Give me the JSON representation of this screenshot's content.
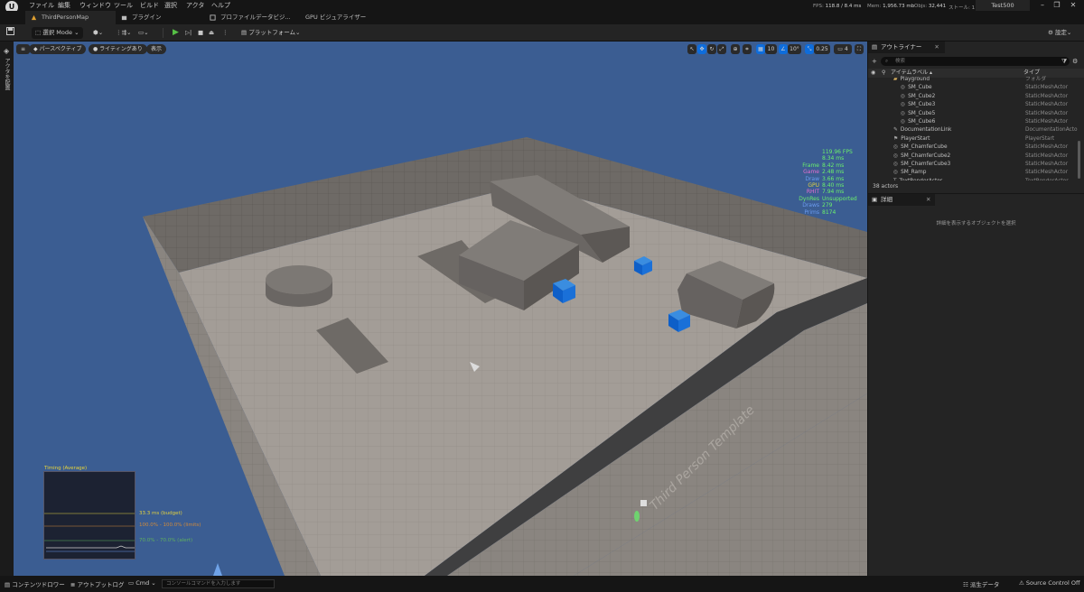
{
  "menubar": {
    "items": [
      "ファイル",
      "編集",
      "ウィンドウ",
      "ツール",
      "ビルド",
      "選択",
      "アクタ",
      "ヘルプ"
    ],
    "stats": {
      "fps_label": "FPS:",
      "fps_value": "118.8 / 8.4 ms",
      "mem_label": "Mem:",
      "mem_value": "1,956.73 mb",
      "objs_label": "Objs:",
      "objs_value": "32,441",
      "extra": "ストール: 1"
    },
    "project": "Test500"
  },
  "tabs": {
    "map": "ThirdPersonMap",
    "plugin": "プラグイン",
    "profile": "プロファイルデータビジ...",
    "gpu": "GPU ビジュアライザー"
  },
  "toolbar": {
    "mode": "選択 Mode",
    "platform": "プラットフォーム",
    "settings": "設定"
  },
  "leftstrip": {
    "label": "アクタを配置"
  },
  "viewport": {
    "perspective": "パースペクティブ",
    "lighting": "ライティングあり",
    "show": "表示",
    "grid_snap": "10",
    "rot_snap": "10°",
    "scale_snap": "0.25",
    "camera_speed": "4",
    "perf": [
      {
        "label": "",
        "value": "119.96 FPS",
        "color": "#6cf06c"
      },
      {
        "label": "",
        "value": "8.34 ms",
        "color": "#6cf06c"
      },
      {
        "label": "Frame",
        "value": "8.42 ms",
        "color": "#6cf06c"
      },
      {
        "label": "Game",
        "value": "2.48 ms",
        "color": "#e56fd0"
      },
      {
        "label": "Draw",
        "value": "3.66 ms",
        "color": "#6c9cf0"
      },
      {
        "label": "GPU",
        "value": "8.40 ms",
        "color": "#e0d040"
      },
      {
        "label": "RHIT",
        "value": "7.94 ms",
        "color": "#e56fd0"
      },
      {
        "label": "DynRes",
        "value": "Unsupported",
        "color": "#6cf06c"
      },
      {
        "label": "Draws",
        "value": "279",
        "color": "#6c9cf0"
      },
      {
        "label": "Prims",
        "value": "8174",
        "color": "#6c9cf0"
      }
    ],
    "graph": {
      "title": "Timing (Average)",
      "budget": "33.3 ms (budget)",
      "range1": "100.0% - 100.0% (limits)",
      "range2": "70.0% - 70.0% (alert)"
    }
  },
  "outliner": {
    "tab": "アウトライナー",
    "search_placeholder": "検索",
    "col_label": "アイテムラベル",
    "col_type": "タイプ",
    "rows": [
      {
        "label": "Playground",
        "type": "フォルダ",
        "indent": 1,
        "icon": "folder"
      },
      {
        "label": "SM_Cube",
        "type": "StaticMeshActor",
        "indent": 2,
        "icon": "mesh"
      },
      {
        "label": "SM_Cube2",
        "type": "StaticMeshActor",
        "indent": 2,
        "icon": "mesh"
      },
      {
        "label": "SM_Cube3",
        "type": "StaticMeshActor",
        "indent": 2,
        "icon": "mesh"
      },
      {
        "label": "SM_Cube5",
        "type": "StaticMeshActor",
        "indent": 2,
        "icon": "mesh"
      },
      {
        "label": "SM_Cube6",
        "type": "StaticMeshActor",
        "indent": 2,
        "icon": "mesh"
      },
      {
        "label": "DocumentationLink",
        "type": "DocumentationActo",
        "indent": 1,
        "icon": "doc"
      },
      {
        "label": "PlayerStart",
        "type": "PlayerStart",
        "indent": 1,
        "icon": "player"
      },
      {
        "label": "SM_ChamferCube",
        "type": "StaticMeshActor",
        "indent": 1,
        "icon": "mesh"
      },
      {
        "label": "SM_ChamferCube2",
        "type": "StaticMeshActor",
        "indent": 1,
        "icon": "mesh"
      },
      {
        "label": "SM_ChamferCube3",
        "type": "StaticMeshActor",
        "indent": 1,
        "icon": "mesh"
      },
      {
        "label": "SM_Ramp",
        "type": "StaticMeshActor",
        "indent": 1,
        "icon": "mesh"
      },
      {
        "label": "TextRenderActor",
        "type": "TextRenderActor",
        "indent": 1,
        "icon": "text"
      }
    ],
    "count": "38 actors"
  },
  "details": {
    "tab": "詳細",
    "hint": "詳細を表示するオブジェクトを選択"
  },
  "bottombar": {
    "content_drawer": "コンテンツドロワー",
    "output_log": "アウトプットログ",
    "cmd": "Cmd",
    "cmd_placeholder": "コンソールコマンドを入力します",
    "derived_data": "派生データ",
    "source_control": "Source Control Off"
  },
  "colors": {
    "viewport_bg": "#3b5d92",
    "accent_blue": "#0e6ddc",
    "play_green": "#56c046"
  }
}
